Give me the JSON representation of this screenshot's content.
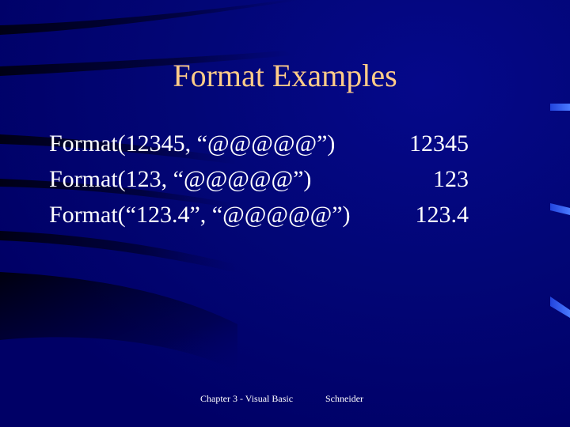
{
  "slide": {
    "title": "Format Examples",
    "examples": [
      {
        "expression": "Format(12345, “@@@@@”)",
        "result": "12345"
      },
      {
        "expression": "Format(123, “@@@@@”)",
        "result": "123"
      },
      {
        "expression": "Format(“123.4”, “@@@@@”)",
        "result": "123.4"
      }
    ],
    "footer": {
      "left": "Chapter 3 - Visual Basic",
      "right": "Schneider"
    }
  },
  "colors": {
    "background": "#000066",
    "title": "#ffcc88",
    "body_text": "#ffffff",
    "accent": "#3366ff"
  }
}
